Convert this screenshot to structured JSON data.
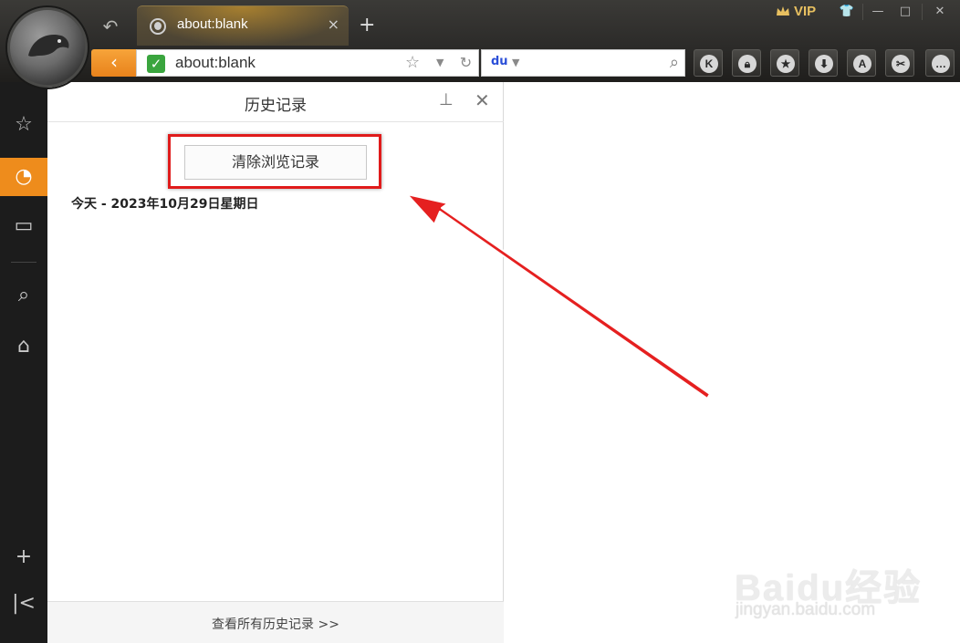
{
  "window": {
    "vip_label": "VIP",
    "controls": [
      "shirt-icon",
      "minimize-icon",
      "maximize-icon",
      "close-icon"
    ]
  },
  "tab": {
    "title": "about:blank",
    "close": "×",
    "new_tab": "+"
  },
  "navbar": {
    "back": "‹",
    "url": "about:blank",
    "reload": "↻",
    "search_engine_icon": "baidu-paw-icon",
    "toolbar_buttons": [
      "K",
      "lock",
      "star",
      "download",
      "A",
      "scissors",
      "more"
    ]
  },
  "dock": {
    "items": [
      "favorites-star-icon",
      "history-clock-icon",
      "toolbox-icon",
      "search-icon",
      "game-controller-icon"
    ],
    "add": "+",
    "collapse": "|<"
  },
  "history_panel": {
    "title": "历史记录",
    "clear_button": "清除浏览记录",
    "date_header": "今天 - 2023年10月29日星期日",
    "view_all": "查看所有历史记录 >>"
  },
  "watermark": {
    "brand": "Baidu经验",
    "url": "jingyan.baidu.com"
  },
  "colors": {
    "accent_orange": "#ee8c1c",
    "annotation_red": "#e01b1b",
    "secure_green": "#3aa53e"
  }
}
